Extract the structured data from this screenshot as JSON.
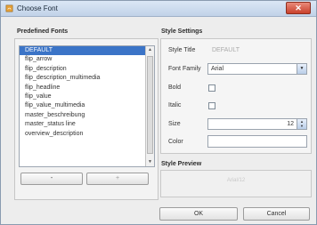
{
  "window": {
    "title": "Choose Font",
    "close_symbol": "✕"
  },
  "predefined": {
    "label": "Predefined Fonts",
    "items": [
      "DEFAULT",
      "flip_arrow",
      "flip_description",
      "flip_description_multimedia",
      "flip_headline",
      "flip_value",
      "flip_value_multimedia",
      "master_beschreibung",
      "master_status line",
      "overview_description"
    ],
    "selected_index": 0,
    "add_label": "+",
    "remove_label": "-"
  },
  "style_settings": {
    "label": "Style Settings",
    "style_title_label": "Style Title",
    "style_title_value": "DEFAULT",
    "font_family_label": "Font Family",
    "font_family_value": "Arial",
    "bold_label": "Bold",
    "italic_label": "Italic",
    "size_label": "Size",
    "size_value": "12",
    "color_label": "Color",
    "color_value": ""
  },
  "style_preview": {
    "label": "Style Preview",
    "sample_text": "Arial/12"
  },
  "footer": {
    "ok_label": "OK",
    "cancel_label": "Cancel"
  }
}
